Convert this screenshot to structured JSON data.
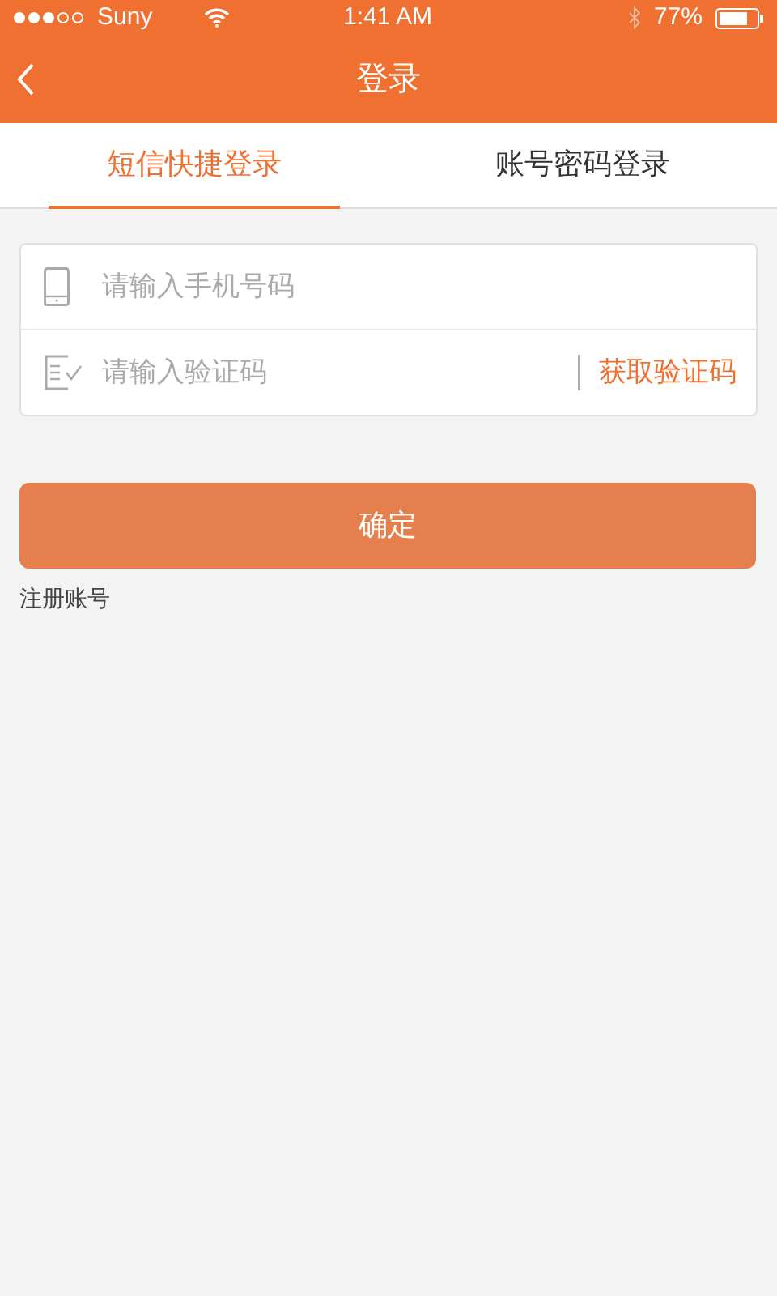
{
  "status_bar": {
    "carrier": "Suny",
    "time": "1:41 AM",
    "battery": "77%"
  },
  "nav": {
    "title": "登录"
  },
  "tabs": [
    {
      "label": "短信快捷登录",
      "selected": true
    },
    {
      "label": "账号密码登录",
      "selected": false
    }
  ],
  "form": {
    "phone": {
      "placeholder": "请输入手机号码"
    },
    "code": {
      "placeholder": "请输入验证码"
    },
    "get_code": "获取验证码"
  },
  "confirm_button": "确定",
  "register_link": "注册账号"
}
